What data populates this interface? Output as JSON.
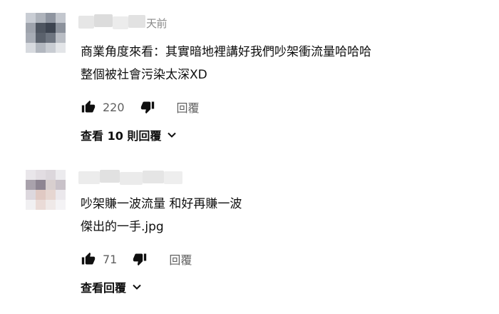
{
  "comments": [
    {
      "timestamp": "天前",
      "lines": [
        "商業角度來看：其實暗地裡講好我們吵架衝流量哈哈哈",
        "整個被社會污染太深XD"
      ],
      "likes": "220",
      "reply_label": "回覆",
      "view_replies_label": "查看 10 則回覆"
    },
    {
      "timestamp": "",
      "lines": [
        "吵架賺一波流量 和好再賺一波",
        "傑出的一手.jpg"
      ],
      "likes": "71",
      "reply_label": "回覆",
      "view_replies_label": "查看回覆"
    }
  ],
  "icons": {
    "like": "thumbs-up-icon",
    "dislike": "thumbs-down-icon",
    "expand": "chevron-down-icon"
  },
  "colors": {
    "text": "#0f0f0f",
    "secondary": "#606060",
    "background": "#ffffff"
  }
}
